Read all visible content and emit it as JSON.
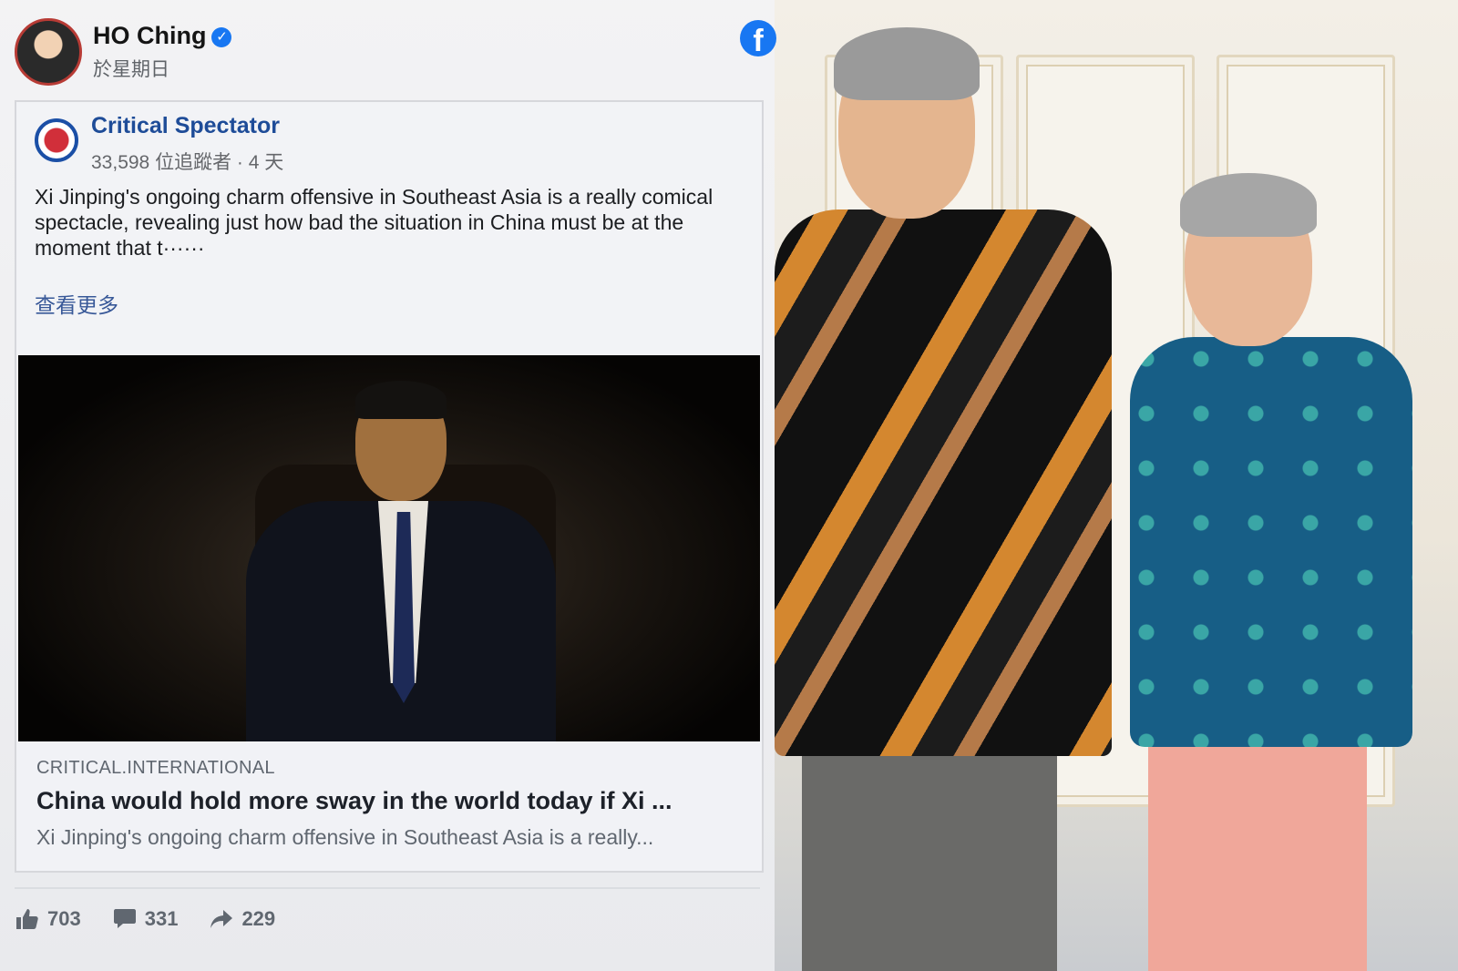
{
  "post": {
    "author": "HO Ching",
    "time": "於星期日"
  },
  "shared": {
    "page_name": "Critical Spectator",
    "meta": "33,598 位追蹤者 · 4 天",
    "text": "Xi Jinping's ongoing charm offensive in Southeast Asia is a really comical spectacle, revealing just how bad the situation in China must be at the moment that t······",
    "see_more": "查看更多"
  },
  "link": {
    "source": "CRITICAL.INTERNATIONAL",
    "title": "China would hold more sway in the world today if Xi ...",
    "description": "Xi Jinping's ongoing charm offensive in Southeast Asia is a really..."
  },
  "stats": {
    "likes": "703",
    "comments": "331",
    "shares": "229"
  },
  "icons": {
    "brand": "facebook-icon",
    "verified": "verified-badge-icon",
    "like": "thumbs-up-icon",
    "comment": "comment-icon",
    "share": "share-arrow-icon"
  },
  "colors": {
    "facebook_blue": "#1877f2",
    "link_blue": "#385898",
    "page_name_blue": "#1e4c98"
  }
}
